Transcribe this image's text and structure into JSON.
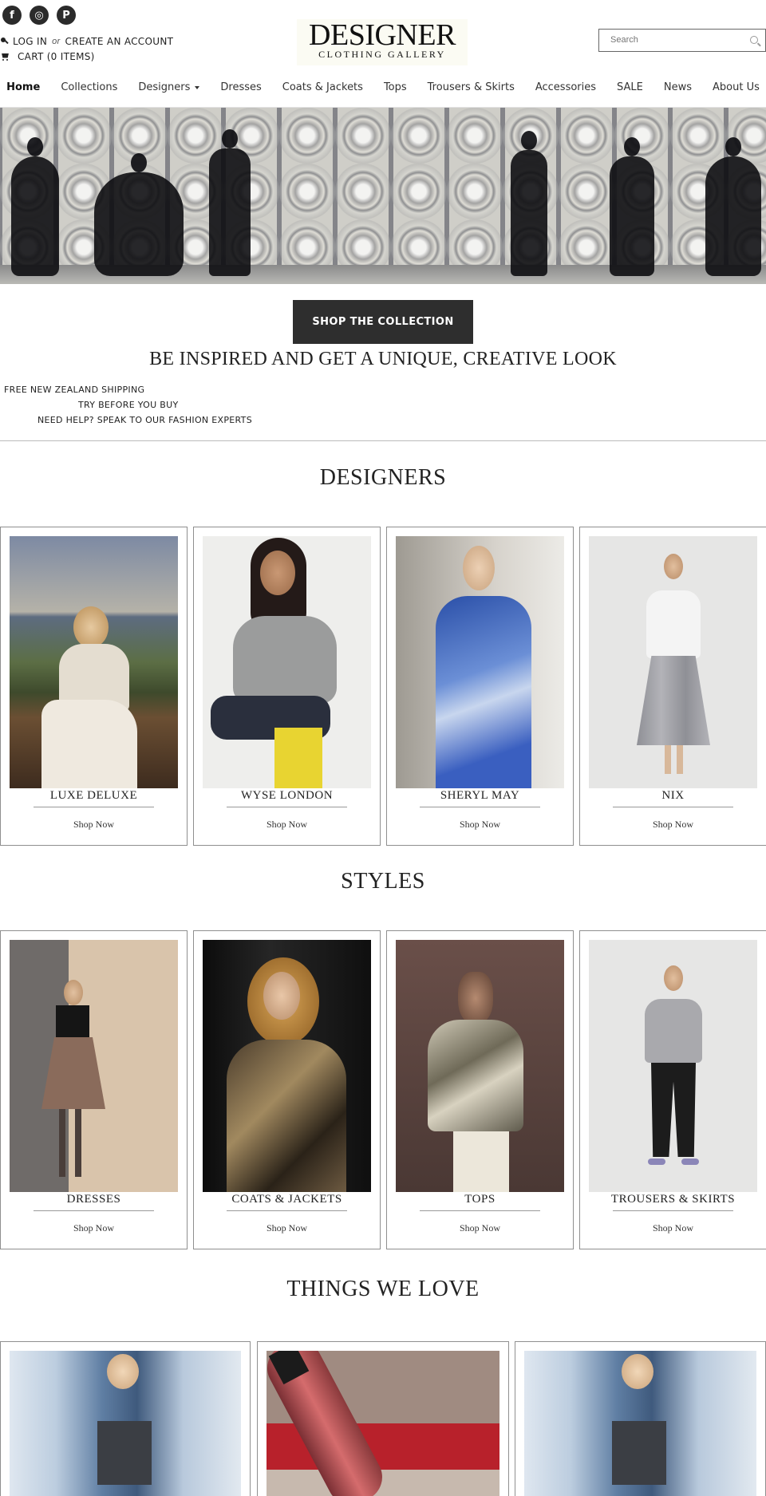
{
  "social": {
    "items": [
      {
        "name": "facebook-icon",
        "glyph": "f"
      },
      {
        "name": "instagram-icon",
        "glyph": "◎"
      },
      {
        "name": "pinterest-icon",
        "glyph": "P"
      }
    ]
  },
  "account": {
    "login": "LOG IN",
    "or": "or",
    "create": "CREATE AN ACCOUNT",
    "cart": "CART (0 ITEMS)"
  },
  "logo": {
    "main": "DESIGNER",
    "sub": "CLOTHING GALLERY"
  },
  "search": {
    "placeholder": "Search"
  },
  "nav": {
    "items": [
      "Home",
      "Collections",
      "Designers",
      "Dresses",
      "Coats & Jackets",
      "Tops",
      "Trousers & Skirts",
      "Accessories",
      "SALE",
      "News",
      "About Us"
    ]
  },
  "hero": {
    "cta": "SHOP THE COLLECTION",
    "tagline": "BE INSPIRED AND GET A UNIQUE, CREATIVE LOOK"
  },
  "perks": [
    "FREE NEW ZEALAND SHIPPING",
    "TRY BEFORE YOU BUY",
    "NEED HELP? SPEAK TO OUR FASHION EXPERTS"
  ],
  "designers": {
    "title": "DESIGNERS",
    "cards": [
      {
        "name": "LUXE DELUXE",
        "cta": "Shop Now"
      },
      {
        "name": "WYSE LONDON",
        "cta": "Shop Now"
      },
      {
        "name": "SHERYL MAY",
        "cta": "Shop Now"
      },
      {
        "name": "NIX",
        "cta": "Shop Now"
      }
    ]
  },
  "styles": {
    "title": "STYLES",
    "cards": [
      {
        "name": "DRESSES",
        "cta": "Shop Now"
      },
      {
        "name": "COATS & JACKETS",
        "cta": "Shop Now"
      },
      {
        "name": "TOPS",
        "cta": "Shop Now"
      },
      {
        "name": "TROUSERS & SKIRTS",
        "cta": "Shop Now"
      }
    ]
  },
  "love": {
    "title": "THINGS WE LOVE"
  },
  "colors": {
    "dark_button": "#2e2e2e",
    "border": "#8f8f8f",
    "text": "#222222"
  }
}
